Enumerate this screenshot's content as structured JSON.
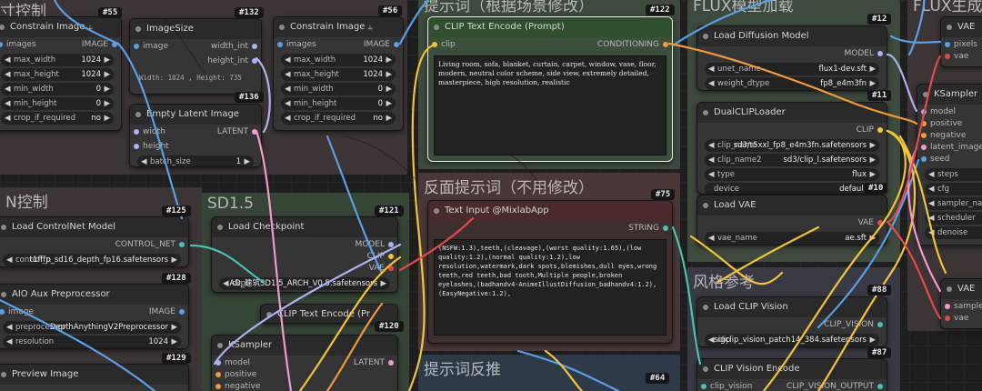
{
  "groups": {
    "g1": "寸控制",
    "g2": "N控制",
    "g3": "SD1.5",
    "g4": "提示词（根据场景修改）",
    "g5": "反面提示词（不用修改）",
    "g6": "提示词反推",
    "g7": "FLUX模型加载",
    "g8": "风格参考",
    "g9": "FLUX生成"
  },
  "badges": {
    "b55": "#55",
    "b132": "#132",
    "b56": "#56",
    "b136": "#136",
    "b125": "#125",
    "b121": "#121",
    "b128": "#128",
    "b120": "#120",
    "b129": "#129",
    "b122": "#122",
    "b75": "#75",
    "b64": "#64",
    "b12": "#12",
    "b11": "#11",
    "b10": "#10",
    "b88": "#88",
    "b87": "#87"
  },
  "nodes": {
    "constrain1": {
      "title": "Constrain Image",
      "icon": "⥿",
      "in_images": "images",
      "out_image": "IMAGE",
      "w": [
        {
          "label": "max_width",
          "value": "1024"
        },
        {
          "label": "max_height",
          "value": "1024"
        },
        {
          "label": "min_width",
          "value": "0"
        },
        {
          "label": "min_height",
          "value": "0"
        },
        {
          "label": "crop_if_required",
          "value": "no"
        }
      ]
    },
    "imagesize": {
      "title": "ImageSize",
      "in_image": "image",
      "out_w": "width_int",
      "out_h": "height_int",
      "text": "Width: 1024 , Height: 735"
    },
    "constrain2": {
      "title": "Constrain Image",
      "icon": "⥿",
      "in_images": "images",
      "out_image": "IMAGE",
      "w": [
        {
          "label": "max_width",
          "value": "1024"
        },
        {
          "label": "max_height",
          "value": "1024"
        },
        {
          "label": "min_width",
          "value": "0"
        },
        {
          "label": "min_height",
          "value": "0"
        },
        {
          "label": "crop_if_required",
          "value": "no"
        }
      ]
    },
    "latent": {
      "title": "Empty Latent Image",
      "in_w": "width",
      "in_h": "height",
      "out": "LATENT",
      "w": [
        {
          "label": "batch_size",
          "value": "1"
        }
      ]
    },
    "controlnet": {
      "title": "Load ControlNet Model",
      "out": "CONTROL_NET",
      "w": [
        {
          "label": "control_n",
          "value": "t1fffp_sd16_depth_fp16.safetensors"
        }
      ]
    },
    "aux": {
      "title": "AIO Aux Preprocessor",
      "in": "image",
      "out": "IMAGE",
      "w": [
        {
          "label": "preprocessor",
          "value": "DepthAnythingV2Preprocessor"
        },
        {
          "label": "resolution",
          "value": "1024"
        }
      ]
    },
    "preview": {
      "title": "Preview Image"
    },
    "checkpoint": {
      "title": "Load Checkpoint",
      "out_model": "MODEL",
      "out_clip": "CLIP",
      "out_vae": "VAE",
      "w": [
        {
          "label": "ckpt",
          "value": "AD_建筑SD1.5_ARCH_V0.5.safetensors"
        }
      ]
    },
    "clipenc_small": {
      "title": "CLIP Text Encode (Pr"
    },
    "ksampler_sd": {
      "title": "KSampler",
      "in_model": "model",
      "in_pos": "positive",
      "in_neg": "negative",
      "out": "LATENT"
    },
    "clip_prompt": {
      "title": "CLIP Text Encode (Prompt)",
      "in": "clip",
      "out": "CONDITIONING",
      "text": "Living room, sofa, blanket, curtain, carpet, window, vase, floor, modern, neutral color scheme, side view, extremely detailed, masterpiece, high resolution, realistic"
    },
    "text_input": {
      "title": "Text Input @MixlabApp",
      "out": "STRING",
      "text": "(NSFW:1.3),teeth,(cleavage),(worst quality:1.65),(low quality:1.2),(normal quality:1.2),low resolution,watermark,dark spots,blemishes,dull eyes,wrong teeth,red teeth,bad tooth,Multiple people,broken eyelashes,(badhandv4-AnimeIllustDiffusion_badhandv4:1.2),(EasyNegative:1.2),"
    },
    "diffusion": {
      "title": "Load Diffusion Model",
      "out": "MODEL",
      "w": [
        {
          "label": "unet_name",
          "value": "flux1-dev.sft"
        },
        {
          "label": "weight_dtype",
          "value": "fp8_e4m3fn"
        }
      ]
    },
    "dualclip": {
      "title": "DualCLIPLoader",
      "out": "CLIP",
      "w": [
        {
          "label": "clip_name",
          "value": "sd3/t5xxl_fp8_e4m3fn.safetensors"
        },
        {
          "label": "clip_name2",
          "value": "sd3/clip_l.safetensors"
        },
        {
          "label": "type",
          "value": "flux"
        },
        {
          "label": "device",
          "value": "default"
        }
      ]
    },
    "vae": {
      "title": "Load VAE",
      "out": "VAE",
      "w": [
        {
          "label": "vae_name",
          "value": "ae.sft"
        }
      ]
    },
    "clipvision": {
      "title": "Load CLIP Vision",
      "out": "CLIP_VISION",
      "w": [
        {
          "label": "clip",
          "value": "sigclip_vision_patch14_384.safetensors"
        }
      ]
    },
    "clipvisionenc": {
      "title": "CLIP Vision Encode",
      "in": "clip_vision",
      "out": "CLIP_VISION_OUTPUT"
    },
    "vae_right": {
      "title": "VAE",
      "in_pixels": "pixels",
      "in_vae": "vae"
    },
    "ksampler_flux": {
      "title": "KSampler",
      "in": [
        "model",
        "positive",
        "negative",
        "latent_image",
        "seed"
      ],
      "w": [
        "steps",
        "cfg",
        "sampler_name",
        "scheduler",
        "denoise"
      ]
    },
    "vae_right2": {
      "title": "VAE",
      "in_samples": "sample",
      "in_vae": "vae"
    }
  },
  "colors": {
    "wire_blue": "#5aa0e6",
    "wire_yellow": "#f2c43a",
    "wire_pink": "#f29ad0",
    "wire_red": "#e34b4b",
    "wire_cyan": "#49c1b4",
    "wire_lavender": "#aab2f2",
    "wire_orange": "#f29a3a"
  }
}
